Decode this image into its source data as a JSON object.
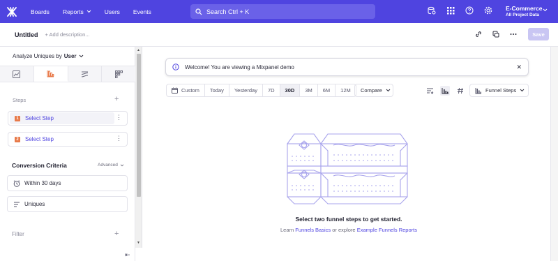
{
  "colors": {
    "brand": "#4f44e0",
    "step_badge": "#e87a4a",
    "save_disabled": "#c9c6f3"
  },
  "nav": {
    "items": [
      {
        "label": "Boards",
        "has_chevron": false
      },
      {
        "label": "Reports",
        "has_chevron": true
      },
      {
        "label": "Users",
        "has_chevron": false
      },
      {
        "label": "Events",
        "has_chevron": false
      }
    ],
    "search_placeholder": "Search  Ctrl + K",
    "icons": [
      "database-icon",
      "apps-grid-icon",
      "help-icon",
      "settings-icon"
    ],
    "project_name": "E-Commerce",
    "project_scope": "All Project Data"
  },
  "report": {
    "title": "Untitled",
    "description_placeholder": "+ Add description...",
    "toolbar_icons": [
      "link-icon",
      "copy-icon",
      "more-icon"
    ],
    "save_label": "Save"
  },
  "sidebar": {
    "analyze_prefix": "Analyze Uniques by",
    "analyze_value": "User",
    "tabs": [
      "insights-tab",
      "funnels-tab",
      "flows-tab",
      "retention-tab"
    ],
    "steps_label": "Steps",
    "steps": [
      {
        "num": "1",
        "label": "Select Step"
      },
      {
        "num": "2",
        "label": "Select Step"
      }
    ],
    "conversion_title": "Conversion Criteria",
    "advanced_label": "Advanced",
    "criteria": [
      {
        "icon": "clock-icon",
        "label": "Within 30 days"
      },
      {
        "icon": "filter-lines-icon",
        "label": "Uniques"
      }
    ],
    "filter_label": "Filter"
  },
  "main": {
    "welcome_text": "Welcome! You are viewing a Mixpanel demo",
    "date_ranges": [
      {
        "label": "Custom",
        "active": false
      },
      {
        "label": "Today",
        "active": false
      },
      {
        "label": "Yesterday",
        "active": false
      },
      {
        "label": "7D",
        "active": false
      },
      {
        "label": "30D",
        "active": true
      },
      {
        "label": "3M",
        "active": false
      },
      {
        "label": "6M",
        "active": false
      },
      {
        "label": "12M",
        "active": false
      }
    ],
    "compare_label": "Compare",
    "chart_type_label": "Funnel Steps",
    "empty_title": "Select two funnel steps to get started.",
    "empty_learn": "Learn",
    "empty_link1": "Funnels Basics",
    "empty_or": "or explore",
    "empty_link2": "Example Funnels Reports"
  }
}
